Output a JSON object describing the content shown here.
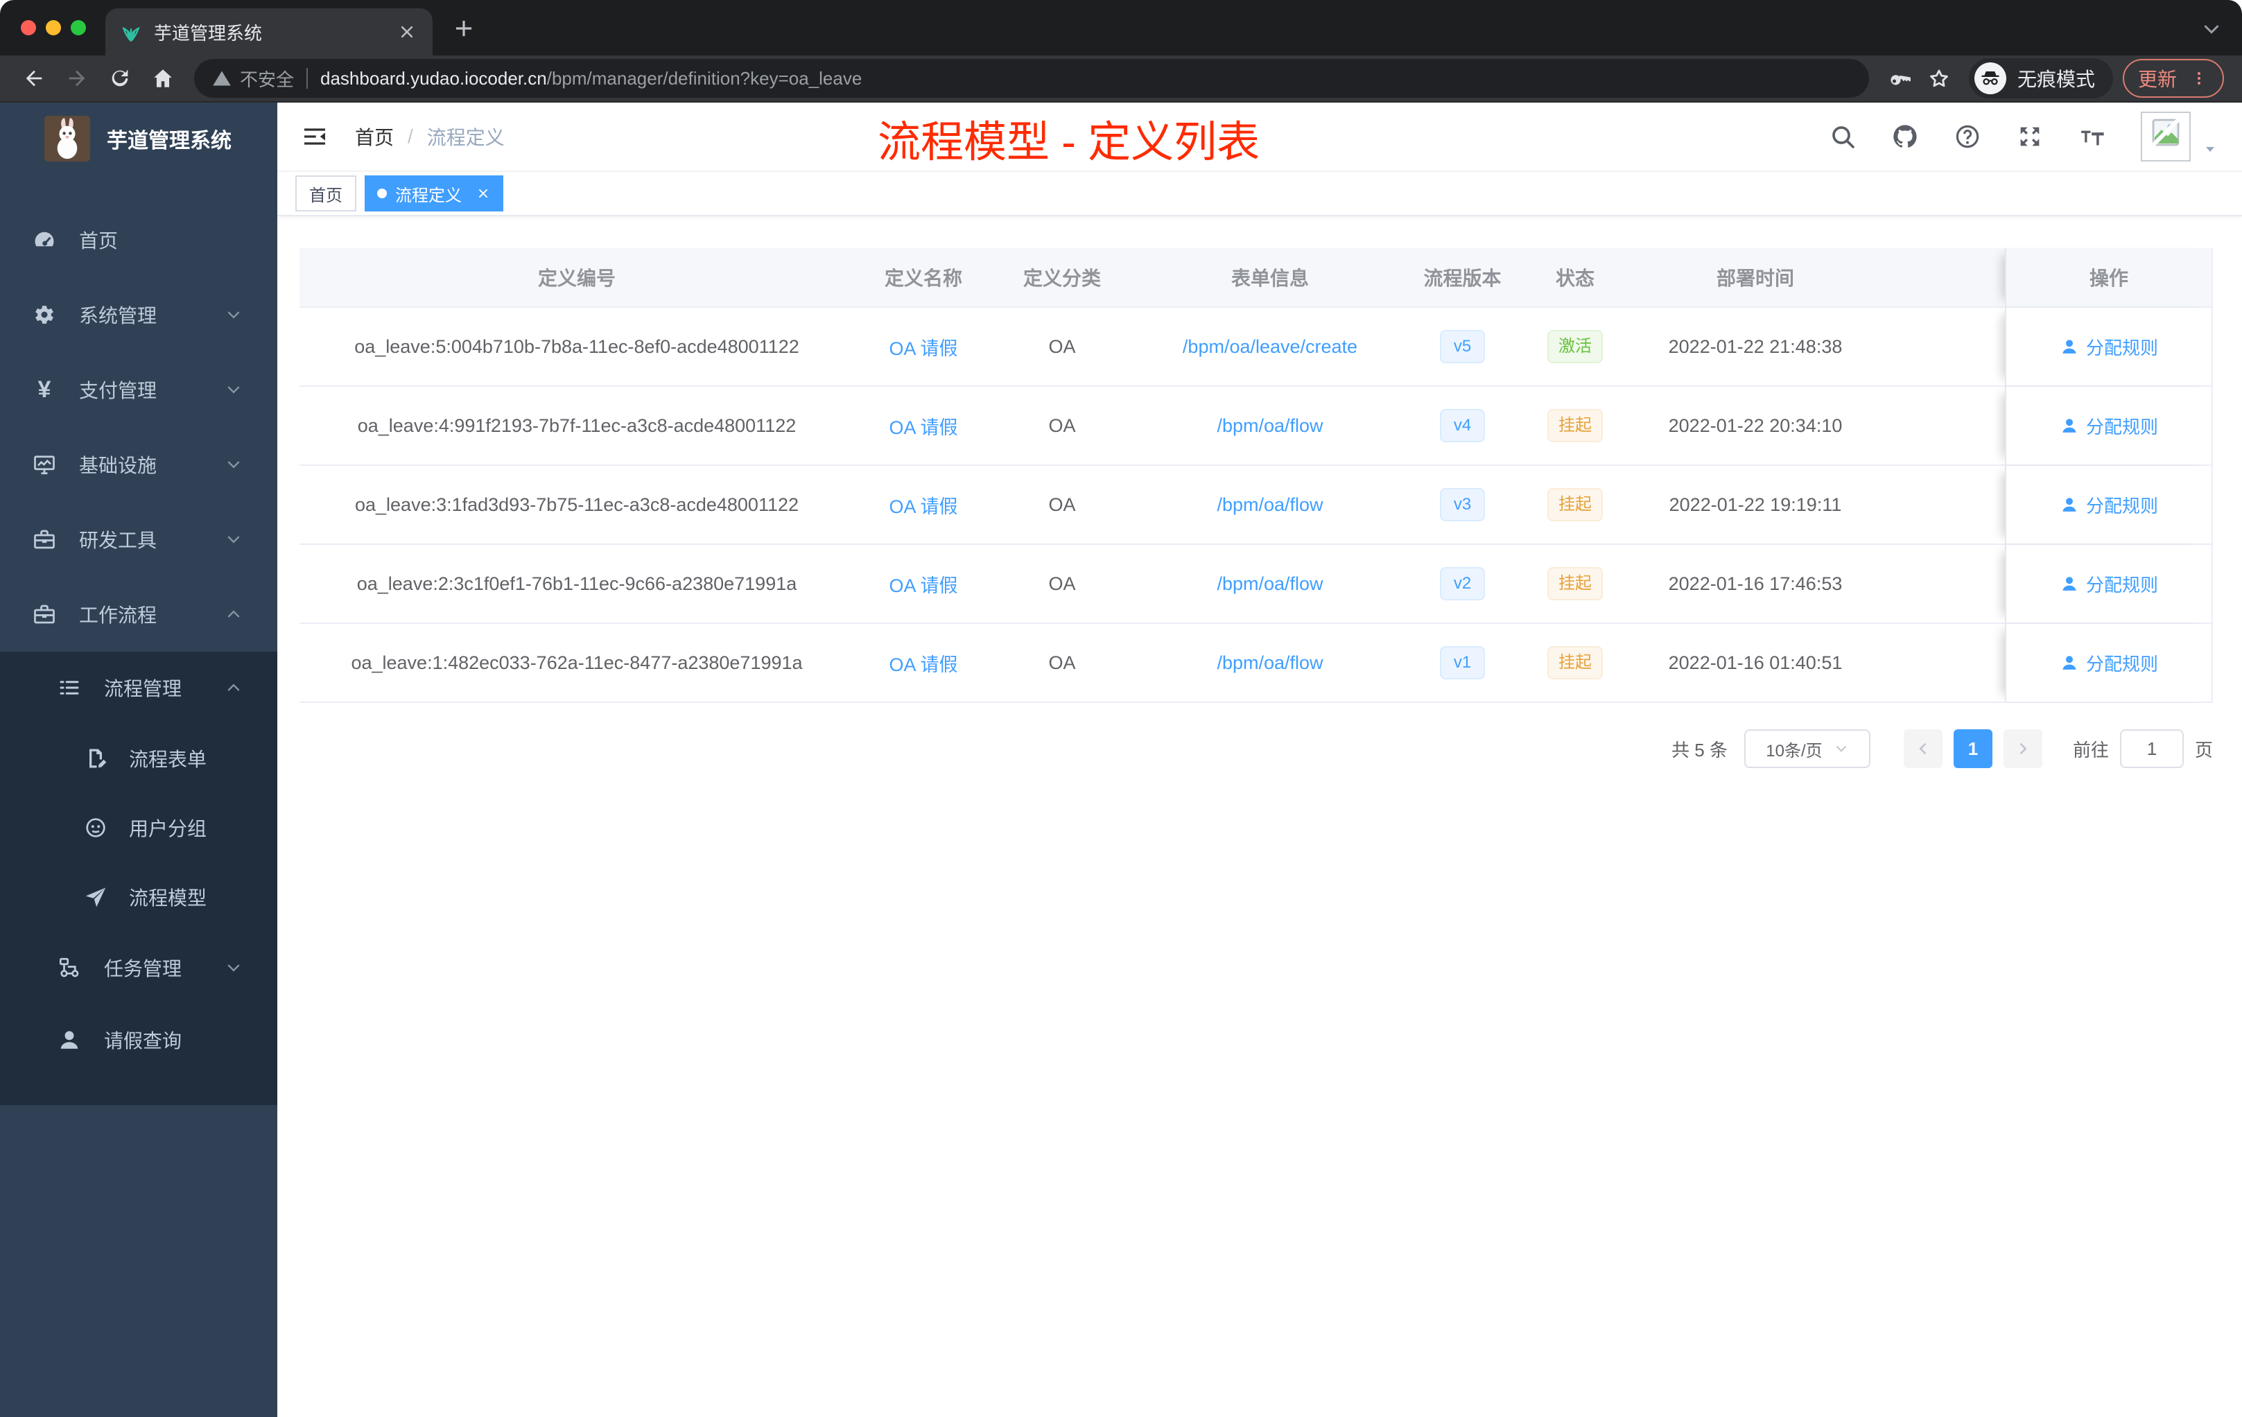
{
  "browser": {
    "tab_title": "芋道管理系统",
    "insecure": "不安全",
    "url_domain": "dashboard.yudao.iocoder.cn",
    "url_path": "/bpm/manager/definition?key=oa_leave",
    "incognito": "无痕模式",
    "update": "更新"
  },
  "sidebar": {
    "title": "芋道管理系统",
    "items": [
      {
        "label": "首页",
        "icon": "gauge-icon"
      },
      {
        "label": "系统管理",
        "icon": "gear-icon",
        "chevron": "down"
      },
      {
        "label": "支付管理",
        "icon": "yen-icon",
        "chevron": "down"
      },
      {
        "label": "基础设施",
        "icon": "monitor-icon",
        "chevron": "down"
      },
      {
        "label": "研发工具",
        "icon": "toolbox-icon",
        "chevron": "down"
      },
      {
        "label": "工作流程",
        "icon": "toolbox-icon",
        "chevron": "up"
      },
      {
        "label": "流程管理",
        "icon": "tree-list-icon",
        "chevron": "up"
      },
      {
        "label": "流程表单",
        "icon": "form-edit-icon"
      },
      {
        "label": "用户分组",
        "icon": "people-icon"
      },
      {
        "label": "流程模型",
        "icon": "paper-plane-icon"
      },
      {
        "label": "任务管理",
        "icon": "tasks-icon",
        "chevron": "down"
      },
      {
        "label": "请假查询",
        "icon": "user-icon"
      }
    ]
  },
  "nav": {
    "breadcrumb": {
      "home": "首页",
      "current": "流程定义"
    },
    "annotation": "流程模型 - 定义列表"
  },
  "tags": {
    "home": "首页",
    "active": "流程定义"
  },
  "table": {
    "columns": [
      "定义编号",
      "定义名称",
      "定义分类",
      "表单信息",
      "流程版本",
      "状态",
      "部署时间",
      "操作"
    ],
    "action_label": "分配规则",
    "rows": [
      {
        "id": "oa_leave:5:004b710b-7b8a-11ec-8ef0-acde48001122",
        "name": "OA 请假",
        "category": "OA",
        "form": "/bpm/oa/leave/create",
        "version": "v5",
        "status": "激活",
        "status_type": "active",
        "time": "2022-01-22 21:48:38"
      },
      {
        "id": "oa_leave:4:991f2193-7b7f-11ec-a3c8-acde48001122",
        "name": "OA 请假",
        "category": "OA",
        "form": "/bpm/oa/flow",
        "version": "v4",
        "status": "挂起",
        "status_type": "suspended",
        "time": "2022-01-22 20:34:10"
      },
      {
        "id": "oa_leave:3:1fad3d93-7b75-11ec-a3c8-acde48001122",
        "name": "OA 请假",
        "category": "OA",
        "form": "/bpm/oa/flow",
        "version": "v3",
        "status": "挂起",
        "status_type": "suspended",
        "time": "2022-01-22 19:19:11"
      },
      {
        "id": "oa_leave:2:3c1f0ef1-76b1-11ec-9c66-a2380e71991a",
        "name": "OA 请假",
        "category": "OA",
        "form": "/bpm/oa/flow",
        "version": "v2",
        "status": "挂起",
        "status_type": "suspended",
        "time": "2022-01-16 17:46:53"
      },
      {
        "id": "oa_leave:1:482ec033-762a-11ec-8477-a2380e71991a",
        "name": "OA 请假",
        "category": "OA",
        "form": "/bpm/oa/flow",
        "version": "v1",
        "status": "挂起",
        "status_type": "suspended",
        "time": "2022-01-16 01:40:51"
      }
    ]
  },
  "pagination": {
    "total": "共 5 条",
    "page_size": "10条/页",
    "page": "1",
    "goto": "前往",
    "unit": "页",
    "goto_value": "1"
  },
  "colors": {
    "primary": "#409eff",
    "success": "#67c23a",
    "warning": "#e6a23c",
    "annotation_red": "#fe2b00",
    "sidebar_bg": "#304156",
    "submenu_bg": "#1f2d3d"
  }
}
